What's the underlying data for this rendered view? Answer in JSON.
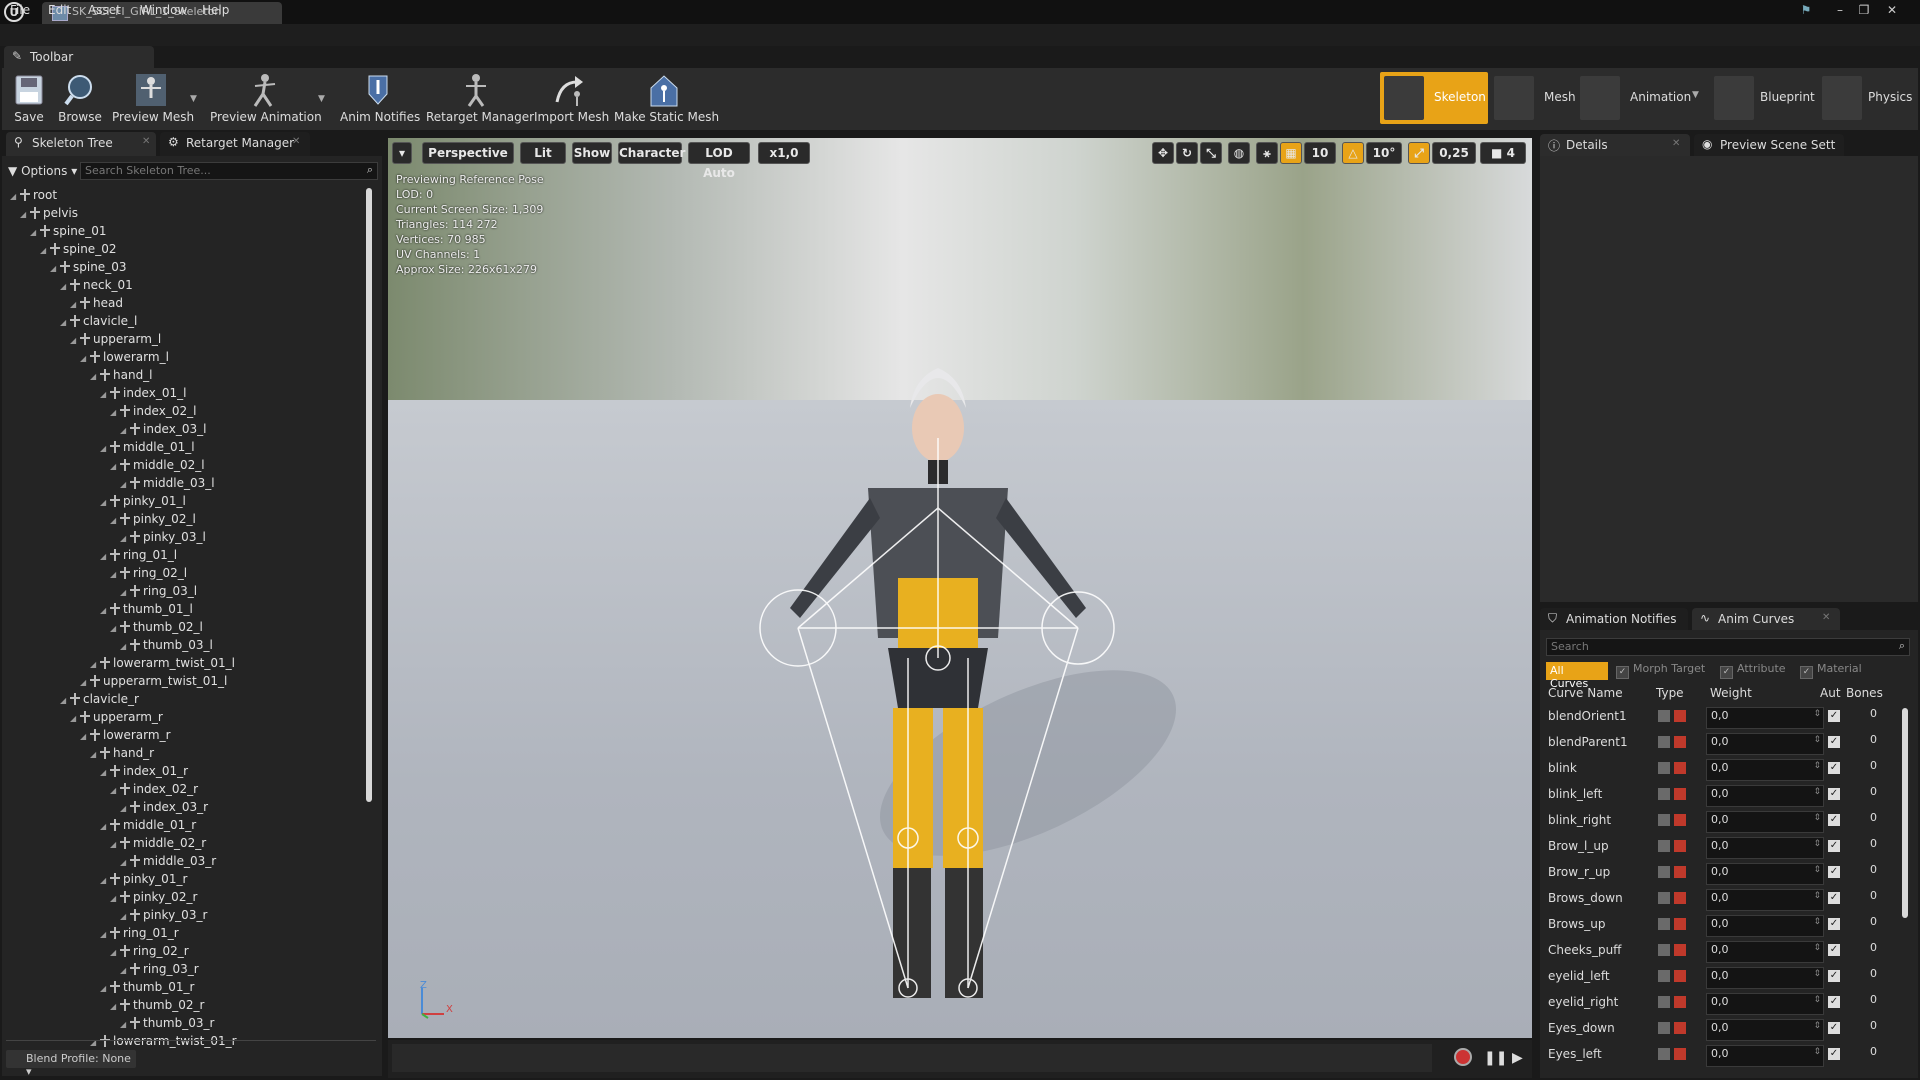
{
  "window": {
    "title": "SK_SCI_FI_GIRL_1_Skeleton"
  },
  "menu": [
    "File",
    "Edit",
    "Asset",
    "Window",
    "Help"
  ],
  "toolbar": {
    "tab_label": "Toolbar",
    "buttons": [
      "Save",
      "Browse",
      "Preview Mesh",
      "Preview Animation",
      "Anim Notifies",
      "Retarget Manager",
      "Import Mesh",
      "Make Static Mesh"
    ]
  },
  "modes": [
    "Skeleton",
    "Mesh",
    "Animation",
    "Blueprint",
    "Physics"
  ],
  "left_tabs": [
    "Skeleton Tree",
    "Retarget Manager"
  ],
  "skeleton_tree": {
    "options_label": "Options",
    "search_placeholder": "Search Skeleton Tree...",
    "bones": [
      {
        "name": "root",
        "depth": 0
      },
      {
        "name": "pelvis",
        "depth": 1
      },
      {
        "name": "spine_01",
        "depth": 2
      },
      {
        "name": "spine_02",
        "depth": 3
      },
      {
        "name": "spine_03",
        "depth": 4
      },
      {
        "name": "neck_01",
        "depth": 5
      },
      {
        "name": "head",
        "depth": 6
      },
      {
        "name": "clavicle_l",
        "depth": 5
      },
      {
        "name": "upperarm_l",
        "depth": 6
      },
      {
        "name": "lowerarm_l",
        "depth": 7
      },
      {
        "name": "hand_l",
        "depth": 8
      },
      {
        "name": "index_01_l",
        "depth": 9
      },
      {
        "name": "index_02_l",
        "depth": 10
      },
      {
        "name": "index_03_l",
        "depth": 11
      },
      {
        "name": "middle_01_l",
        "depth": 9
      },
      {
        "name": "middle_02_l",
        "depth": 10
      },
      {
        "name": "middle_03_l",
        "depth": 11
      },
      {
        "name": "pinky_01_l",
        "depth": 9
      },
      {
        "name": "pinky_02_l",
        "depth": 10
      },
      {
        "name": "pinky_03_l",
        "depth": 11
      },
      {
        "name": "ring_01_l",
        "depth": 9
      },
      {
        "name": "ring_02_l",
        "depth": 10
      },
      {
        "name": "ring_03_l",
        "depth": 11
      },
      {
        "name": "thumb_01_l",
        "depth": 9
      },
      {
        "name": "thumb_02_l",
        "depth": 10
      },
      {
        "name": "thumb_03_l",
        "depth": 11
      },
      {
        "name": "lowerarm_twist_01_l",
        "depth": 8
      },
      {
        "name": "upperarm_twist_01_l",
        "depth": 7
      },
      {
        "name": "clavicle_r",
        "depth": 5
      },
      {
        "name": "upperarm_r",
        "depth": 6
      },
      {
        "name": "lowerarm_r",
        "depth": 7
      },
      {
        "name": "hand_r",
        "depth": 8
      },
      {
        "name": "index_01_r",
        "depth": 9
      },
      {
        "name": "index_02_r",
        "depth": 10
      },
      {
        "name": "index_03_r",
        "depth": 11
      },
      {
        "name": "middle_01_r",
        "depth": 9
      },
      {
        "name": "middle_02_r",
        "depth": 10
      },
      {
        "name": "middle_03_r",
        "depth": 11
      },
      {
        "name": "pinky_01_r",
        "depth": 9
      },
      {
        "name": "pinky_02_r",
        "depth": 10
      },
      {
        "name": "pinky_03_r",
        "depth": 11
      },
      {
        "name": "ring_01_r",
        "depth": 9
      },
      {
        "name": "ring_02_r",
        "depth": 10
      },
      {
        "name": "ring_03_r",
        "depth": 11
      },
      {
        "name": "thumb_01_r",
        "depth": 9
      },
      {
        "name": "thumb_02_r",
        "depth": 10
      },
      {
        "name": "thumb_03_r",
        "depth": 11
      },
      {
        "name": "lowerarm_twist_01_r",
        "depth": 8
      }
    ],
    "blend_profile": "Blend Profile: None"
  },
  "viewport": {
    "buttons": [
      "Perspective",
      "Lit",
      "Show",
      "Character",
      "LOD Auto",
      "x1,0"
    ],
    "right_values": [
      "10",
      "10°",
      "0,25",
      "4"
    ],
    "info": [
      "Previewing Reference Pose",
      "LOD: 0",
      "Current Screen Size: 1,309",
      "Triangles: 114 272",
      "Vertices: 70 985",
      "UV Channels: 1",
      "Approx Size: 226x61x279"
    ],
    "axis_z": "Z",
    "axis_x": "X"
  },
  "right_tabs": [
    "Details",
    "Preview Scene Sett"
  ],
  "anim_tabs": [
    "Animation Notifies",
    "Anim Curves"
  ],
  "curves": {
    "search_placeholder": "Search",
    "filters": [
      "All Curves",
      "Morph Target",
      "Attribute",
      "Material"
    ],
    "columns": [
      "Curve Name",
      "Type",
      "Weight",
      "Aut",
      "Bones"
    ],
    "rows": [
      {
        "name": "blendOrient1",
        "weight": "0,0",
        "bones": "0"
      },
      {
        "name": "blendParent1",
        "weight": "0,0",
        "bones": "0"
      },
      {
        "name": "blink",
        "weight": "0,0",
        "bones": "0"
      },
      {
        "name": "blink_left",
        "weight": "0,0",
        "bones": "0"
      },
      {
        "name": "blink_right",
        "weight": "0,0",
        "bones": "0"
      },
      {
        "name": "Brow_l_up",
        "weight": "0,0",
        "bones": "0"
      },
      {
        "name": "Brow_r_up",
        "weight": "0,0",
        "bones": "0"
      },
      {
        "name": "Brows_down",
        "weight": "0,0",
        "bones": "0"
      },
      {
        "name": "Brows_up",
        "weight": "0,0",
        "bones": "0"
      },
      {
        "name": "Cheeks_puff",
        "weight": "0,0",
        "bones": "0"
      },
      {
        "name": "eyelid_left",
        "weight": "0,0",
        "bones": "0"
      },
      {
        "name": "eyelid_right",
        "weight": "0,0",
        "bones": "0"
      },
      {
        "name": "Eyes_down",
        "weight": "0,0",
        "bones": "0"
      },
      {
        "name": "Eyes_left",
        "weight": "0,0",
        "bones": "0"
      }
    ]
  },
  "colors": {
    "accent": "#e8a317",
    "panel": "#242424"
  }
}
